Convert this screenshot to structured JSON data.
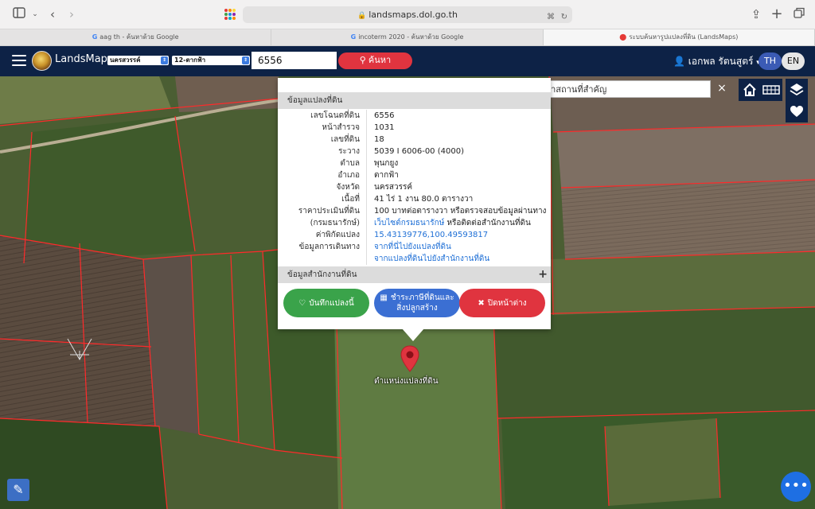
{
  "browser": {
    "url": "landsmaps.dol.go.th",
    "tabs": [
      {
        "icon": "G",
        "label": "aag th - ค้นหาด้วย Google"
      },
      {
        "icon": "G",
        "label": "incoterm 2020 - ค้นหาด้วย Google"
      },
      {
        "icon": "pin",
        "label": "ระบบค้นหารูปแปลงที่ดิน (LandsMaps)"
      }
    ]
  },
  "header": {
    "brand": "LandsMaps",
    "province": "นครสวรรค์",
    "district": "12-ตากฟ้า",
    "search_value": "6556",
    "search_button": "ค้นหา",
    "user_name": "เอกพล รัตนสูตร์",
    "lang_th": "TH",
    "lang_en": "EN"
  },
  "map_tools": {
    "place_search_value": "ค้นหาสถานที่สำคัญ",
    "clear": "×"
  },
  "popup": {
    "section1_title": "ข้อมูลแปลงที่ดิน",
    "section2_title": "ข้อมูลสำนักงานที่ดิน",
    "section2_toggle": "+",
    "rows": [
      {
        "label": "เลขโฉนดที่ดิน",
        "value": "6556"
      },
      {
        "label": "หน้าสำรวจ",
        "value": "1031"
      },
      {
        "label": "เลขที่ดิน",
        "value": "18"
      },
      {
        "label": "ระวาง",
        "value": "5039 I 6006-00 (4000)"
      },
      {
        "label": "ตำบล",
        "value": "พุนกยูง"
      },
      {
        "label": "อำเภอ",
        "value": "ตากฟ้า"
      },
      {
        "label": "จังหวัด",
        "value": "นครสวรรค์"
      },
      {
        "label": "เนื้อที่",
        "value": "41 ไร่ 1 งาน 80.0 ตารางวา"
      },
      {
        "label": "ราคาประเมินที่ดิน",
        "value": "100 บาทต่อตารางวา หรือตรวจสอบข้อมูลผ่านทาง"
      },
      {
        "label": "(กรมธนารักษ์)",
        "value_link": "เว็บไซต์กรมธนารักษ์",
        "value_suffix": " หรือติดต่อสำนักงานที่ดิน"
      },
      {
        "label": "ค่าพิกัดแปลง",
        "value": "15.43139776,100.49593817"
      },
      {
        "label": "ข้อมูลการเดินทาง",
        "value": "จากที่นี่ไปยังแปลงที่ดิน"
      },
      {
        "label": "",
        "value": "จากแปลงที่ดินไปยังสำนักงานที่ดิน"
      }
    ],
    "buttons": {
      "save": "บันทึกแปลงนี้",
      "tax_line1": "ชำระภาษีที่ดินและ",
      "tax_line2": "สิ่งปลูกสร้าง",
      "close": "ปิดหน้าต่าง"
    }
  },
  "marker_label": "ตำแหน่งแปลงที่ดิน",
  "colors": {
    "header_bg": "#0d2246",
    "search_red": "#e0343f",
    "save_green": "#3aa34a",
    "tax_blue": "#3b6fd3",
    "close_red": "#e0343f",
    "link_blue": "#1e6fd6",
    "parcel_line": "#ff2a2a"
  },
  "icons": [
    "sidebar-icon",
    "back-icon",
    "forward-icon",
    "apps-icon",
    "lock-icon",
    "translate-icon",
    "reload-icon",
    "share-icon",
    "new-tab-icon",
    "tabs-icon",
    "menu-icon",
    "search-icon",
    "user-icon",
    "home-icon",
    "grid-icon",
    "layers-icon",
    "heart-icon",
    "ruler-icon",
    "more-icon",
    "map-pin-icon"
  ]
}
